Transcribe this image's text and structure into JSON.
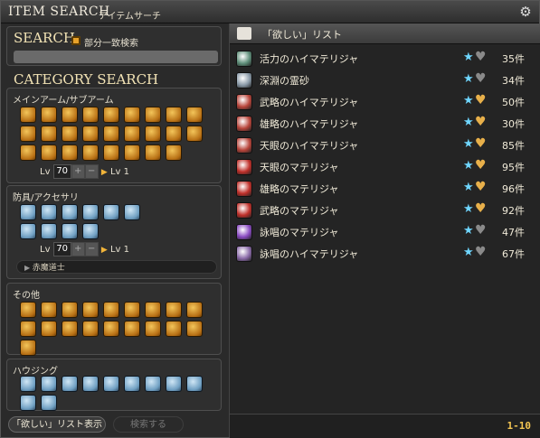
{
  "window": {
    "title": "ITEM SEARCH",
    "subtitle": "アイテムサーチ",
    "settings_icon": "gear-icon"
  },
  "search": {
    "header": "SEARCH",
    "partial_match_label": "部分一致検索",
    "partial_match_checked": true,
    "query": ""
  },
  "category": {
    "header": "CATEGORY SEARCH",
    "main_arms": {
      "label": "メインアーム/サブアーム",
      "level": "70",
      "level_max": "Lv 1",
      "level_label": "Lv",
      "icon_count": 26
    },
    "armor": {
      "label": "防具/アクセサリ",
      "level": "70",
      "level_max": "Lv 1",
      "level_label": "Lv",
      "class_selected": "赤魔道士",
      "icon_count": 10
    },
    "other": {
      "label": "その他",
      "icon_count": 19
    },
    "housing": {
      "label": "ハウジング",
      "icon_count": 11
    }
  },
  "buttons": {
    "show_wishlist": "「欲しい」リスト表示",
    "search": "検索する"
  },
  "wishlist": {
    "title": "「欲しい」リスト",
    "pager": "1-10",
    "items": [
      {
        "name": "活力のハイマテリジャ",
        "count": "35件",
        "heart": "gray",
        "icon_color": "#5f8f7a"
      },
      {
        "name": "深淵の霊砂",
        "count": "34件",
        "heart": "gray",
        "icon_color": "#8a9aa8"
      },
      {
        "name": "武略のハイマテリジャ",
        "count": "50件",
        "heart": "gold",
        "icon_color": "#b8443a"
      },
      {
        "name": "雄略のハイマテリジャ",
        "count": "30件",
        "heart": "gold",
        "icon_color": "#b8443a"
      },
      {
        "name": "天眼のハイマテリジャ",
        "count": "85件",
        "heart": "gold",
        "icon_color": "#b8443a"
      },
      {
        "name": "天眼のマテリジャ",
        "count": "95件",
        "heart": "gold",
        "icon_color": "#c0302a"
      },
      {
        "name": "雄略のマテリジャ",
        "count": "96件",
        "heart": "gold",
        "icon_color": "#c0302a"
      },
      {
        "name": "武略のマテリジャ",
        "count": "92件",
        "heart": "gold",
        "icon_color": "#c0302a"
      },
      {
        "name": "詠唱のマテリジャ",
        "count": "47件",
        "heart": "gray",
        "icon_color": "#8a4bc2"
      },
      {
        "name": "詠唱のハイマテリジャ",
        "count": "67件",
        "heart": "gray",
        "icon_color": "#8a6aa8"
      }
    ]
  }
}
